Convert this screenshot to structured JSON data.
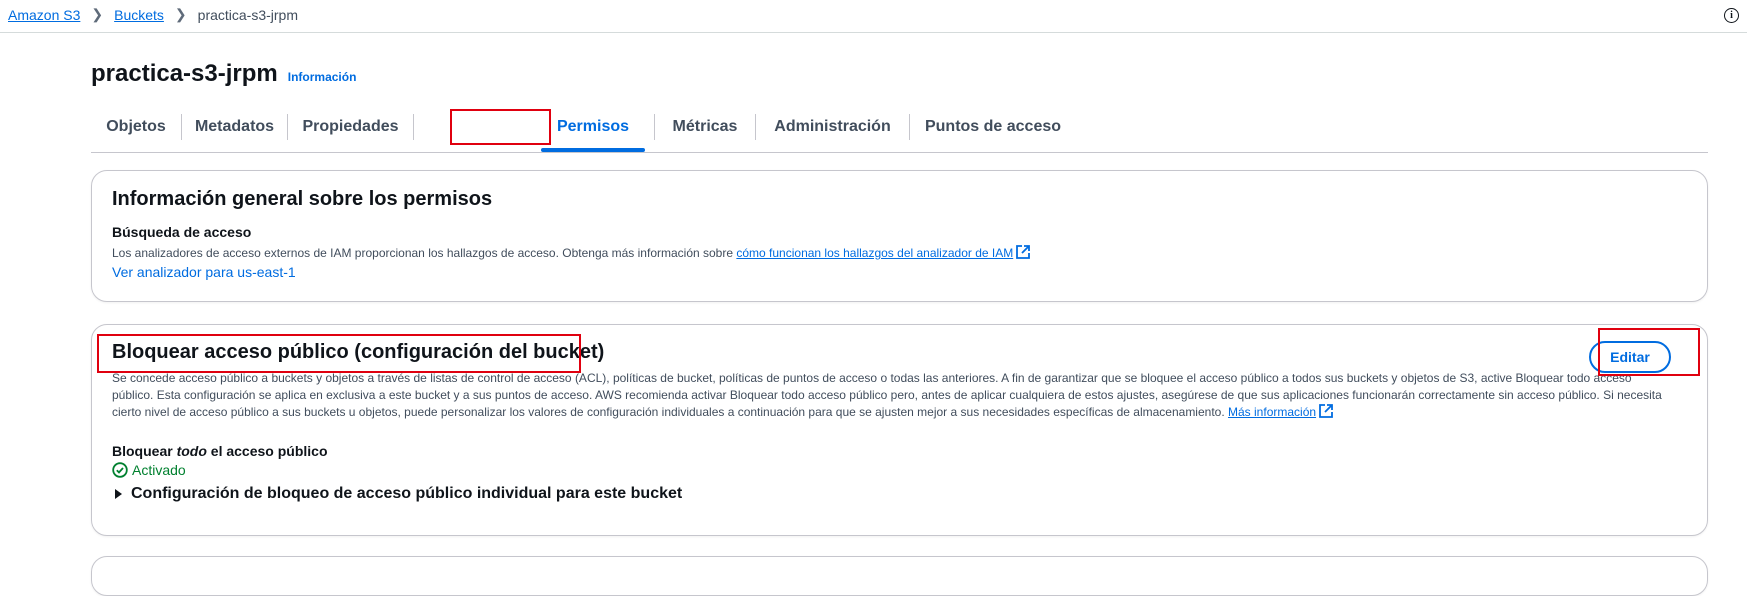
{
  "breadcrumb": {
    "items": [
      "Amazon S3",
      "Buckets"
    ],
    "current": "practica-s3-jrpm"
  },
  "page": {
    "title": "practica-s3-jrpm",
    "info_link": "Información"
  },
  "tabs": [
    "Objetos",
    "Metadatos",
    "Propiedades",
    "Permisos",
    "Métricas",
    "Administración",
    "Puntos de acceso"
  ],
  "active_tab": "Permisos",
  "overview": {
    "title": "Información general sobre los permisos",
    "subtitle": "Búsqueda de acceso",
    "desc": "Los analizadores de acceso externos de IAM proporcionan los hallazgos de acceso. Obtenga más información sobre",
    "desc_link": "cómo funcionan los hallazgos del analizador de IAM",
    "analyzer_link": "Ver analizador para us-east-1"
  },
  "block_public": {
    "title": "Bloquear acceso público (configuración del bucket)",
    "edit_label": "Editar",
    "desc_line1": "Se concede acceso público a buckets y objetos a través de listas de control de acceso (ACL), políticas de bucket, políticas de puntos de acceso o todas las anteriores. A fin de garantizar que se bloquee el acceso público a todos sus buckets y objetos de S3, active Bloquear todo acceso",
    "desc_line2": "público. Esta configuración se aplica en exclusiva a este bucket y a sus puntos de acceso. AWS recomienda activar Bloquear todo acceso público pero, antes de aplicar cualquiera de estos ajustes, asegúrese de que sus aplicaciones funcionarán correctamente sin acceso público. Si necesita",
    "desc_line3": "cierto nivel de acceso público a sus buckets u objetos, puede personalizar los valores de configuración individuales a continuación para que se ajusten mejor a sus necesidades específicas de almacenamiento.",
    "more_info": "Más información",
    "block_all_pre": "Bloquear ",
    "block_all_em": "todo",
    "block_all_post": " el acceso público",
    "status": "Activado",
    "expander": "Configuración de bloqueo de acceso público individual para este bucket"
  },
  "colors": {
    "link": "#006ce0",
    "success": "#00802f",
    "highlight": "#e0000f"
  }
}
